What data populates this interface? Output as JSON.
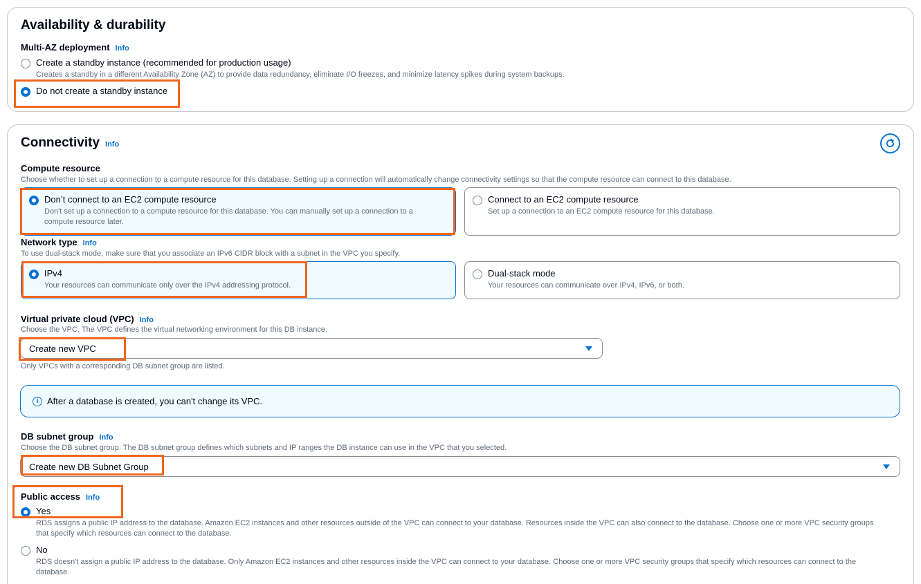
{
  "availability": {
    "title": "Availability & durability",
    "multi_az_label": "Multi-AZ deployment",
    "info": "Info",
    "options": [
      {
        "label": "Create a standby instance (recommended for production usage)",
        "desc": "Creates a standby in a different Availability Zone (AZ) to provide data redundancy, eliminate I/O freezes, and minimize latency spikes during system backups.",
        "selected": false
      },
      {
        "label": "Do not create a standby instance",
        "selected": true
      }
    ]
  },
  "connectivity": {
    "title": "Connectivity",
    "info": "Info",
    "compute": {
      "label": "Compute resource",
      "desc": "Choose whether to set up a connection to a compute resource for this database. Setting up a connection will automatically change connectivity settings so that the compute resource can connect to this database.",
      "options": [
        {
          "label": "Don’t connect to an EC2 compute resource",
          "desc1": "Don't set up a connection to a compute resource for this database. You can manually set up a connection to a",
          "desc2": "compute resource later.",
          "selected": true
        },
        {
          "label": "Connect to an EC2 compute resource",
          "desc": "Set up a connection to an EC2 compute resource for this database.",
          "selected": false
        }
      ]
    },
    "network": {
      "label": "Network type",
      "info": "Info",
      "desc": "To use dual-stack mode, make sure that you associate an IPv6 CIDR block with a subnet in the VPC you specify.",
      "options": [
        {
          "label": "IPv4",
          "desc": "Your resources can communicate only over the IPv4 addressing protocol.",
          "selected": true
        },
        {
          "label": "Dual-stack mode",
          "desc": "Your resources can communicate over IPv4, IPv6, or both.",
          "selected": false
        }
      ]
    },
    "vpc": {
      "label": "Virtual private cloud (VPC)",
      "info": "Info",
      "desc": "Choose the VPC. The VPC defines the virtual networking environment for this DB instance.",
      "value": "Create new VPC",
      "hint": "Only VPCs with a corresponding DB subnet group are listed."
    },
    "alert": {
      "icon": "info-circle-icon",
      "text": "After a database is created, you can't change its VPC."
    },
    "subnet": {
      "label": "DB subnet group",
      "info": "Info",
      "desc": "Choose the DB subnet group. The DB subnet group defines which subnets and IP ranges the DB instance can use in the VPC that you selected.",
      "value": "Create new DB Subnet Group"
    },
    "public": {
      "label": "Public access",
      "info": "Info",
      "options": [
        {
          "label": "Yes",
          "desc1": "RDS assigns a public IP address to the database. Amazon EC2 instances and other resources outside of the VPC can connect to your database. Resources inside the VPC can also connect to the database. Choose one or more VPC security groups",
          "desc2": "that specify which resources can connect to the database.",
          "selected": true
        },
        {
          "label": "No",
          "desc1": "RDS doesn't assign a public IP address to the database. Only Amazon EC2 instances and other resources inside the VPC can connect to your database. Choose one or more VPC security groups that specify which resources can connect to the",
          "desc2": "database.",
          "selected": false
        }
      ]
    }
  },
  "colors": {
    "accent": "#0972d3",
    "highlight": "#f0661f",
    "selected_tile_bg": "#f0fbff"
  }
}
